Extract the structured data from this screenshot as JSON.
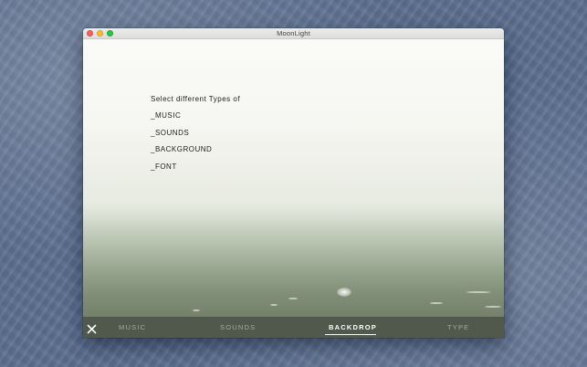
{
  "window": {
    "title": "MoonLight"
  },
  "content": {
    "intro": "Select different Types of",
    "options": [
      "_MUSIC",
      "_SOUNDS",
      "_BACKGROUND",
      "_FONT"
    ]
  },
  "tabbar": {
    "close_icon": "close-icon",
    "tabs": [
      {
        "label": "MUSIC",
        "active": false
      },
      {
        "label": "SOUNDS",
        "active": false
      },
      {
        "label": "BACKDROP",
        "active": true
      },
      {
        "label": "TYPE",
        "active": false
      }
    ]
  },
  "colors": {
    "desktop": "#5a6e8e",
    "tabbar": "#3a4234",
    "active_tab": "#ffffff",
    "inactive_tab": "#a4ab9e"
  }
}
